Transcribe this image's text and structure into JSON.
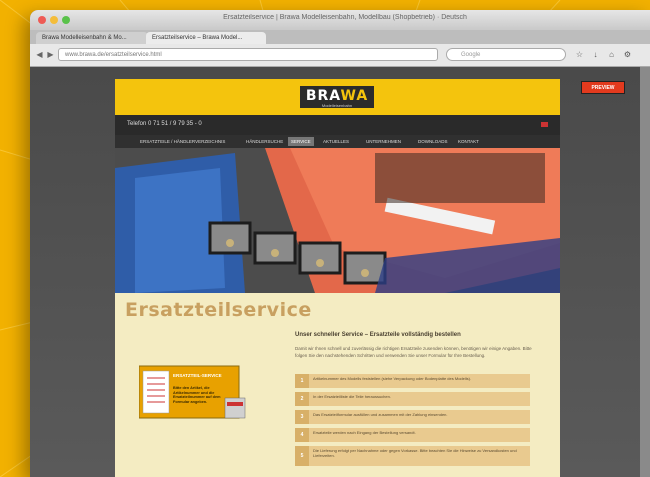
{
  "browser": {
    "window_title": "Ersatzteilservice | Brawa Modelleisenbahn, Modellbau (Shopbetrieb) · Deutsch",
    "tabs": [
      {
        "label": "Brawa Modelleisenbahn & Mo..."
      },
      {
        "label": "Ersatzteilservice – Brawa Model..."
      }
    ],
    "url": "www.brawa.de/ersatzteilservice.html",
    "search_placeholder": "Google"
  },
  "site": {
    "logo": {
      "brand_main": "BRA",
      "brand_accent": "WA",
      "tagline": "Modelleisenbahn"
    },
    "phone": "Telefon 0 71 51 / 9 79 35 - 0",
    "nav": [
      {
        "label": "ERSATZTEILE / HÄNDLERVERZEICHNIS",
        "current": false
      },
      {
        "label": "HÄNDLERSUCHE",
        "current": false
      },
      {
        "label": "SERVICE",
        "current": true
      },
      {
        "label": "AKTUELLES",
        "current": false
      },
      {
        "label": "UNTERNEHMEN",
        "current": false
      },
      {
        "label": "DOWNLOADS",
        "current": false
      },
      {
        "label": "KONTAKT",
        "current": false
      }
    ],
    "overlay_button": "PREVIEW"
  },
  "content": {
    "title": "Ersatzteilservice",
    "sub_heading": "Unser schneller Service – Ersatzteile vollständig bestellen",
    "intro": "Damit wir Ihnen schnell und zuverlässig die richtigen Ersatzteile zusenden können, benötigen wir einige Angaben. Bitte folgen Sie den nachstehenden Schritten und verwenden Sie unser Formular für Ihre Bestellung.",
    "promo": {
      "heading": "ERSATZTEIL-SERVICE",
      "body": "Bitte den Artikel, die Artikelnummer und die Ersatzteilnummer auf dem Formular angeben."
    },
    "steps": [
      {
        "num": "1",
        "text": "Artikelnummer des Modells feststellen (siehe Verpackung oder Bodenplatte des Modells)."
      },
      {
        "num": "2",
        "text": "In der Ersatzteilliste die Teile heraussuchen."
      },
      {
        "num": "3",
        "text": "Das Ersatzteilformular ausfüllen und zusammen mit der Zahlung einsenden."
      },
      {
        "num": "4",
        "text": "Ersatzteile werden nach Eingang der Bestellung versandt."
      },
      {
        "num": "5",
        "text": "Die Lieferung erfolgt per Nachnahme oder gegen Vorkasse. Bitte beachten Sie die Hinweise zu Versandkosten und Lieferzeiten."
      }
    ]
  },
  "colors": {
    "background": "#f2b100",
    "header_yellow": "#f4c40d",
    "nav_dark": "#303030",
    "page_bg": "#f4ecc2",
    "step_bg": "#e9ca8f",
    "accent_red": "#e23a1e"
  }
}
